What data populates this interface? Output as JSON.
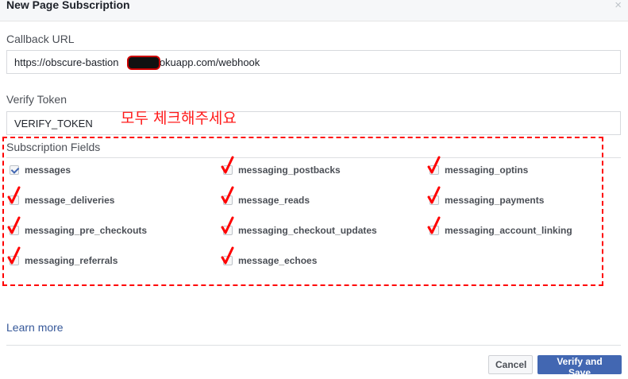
{
  "dialog": {
    "title": "New Page Subscription",
    "close_glyph": "×"
  },
  "callback": {
    "label": "Callback URL",
    "value": "https://obscure-bastion        .herokuapp.com/webhook"
  },
  "verify": {
    "label": "Verify Token",
    "value": "VERIFY_TOKEN"
  },
  "annotation": {
    "text": "모두 체크해주세요",
    "color": "#ff1a1a"
  },
  "subscription": {
    "label": "Subscription Fields",
    "fields": [
      {
        "label": "messages",
        "checked": true,
        "red_mark": false
      },
      {
        "label": "messaging_postbacks",
        "checked": false,
        "red_mark": true
      },
      {
        "label": "messaging_optins",
        "checked": false,
        "red_mark": true
      },
      {
        "label": "message_deliveries",
        "checked": false,
        "red_mark": true
      },
      {
        "label": "message_reads",
        "checked": false,
        "red_mark": true
      },
      {
        "label": "messaging_payments",
        "checked": false,
        "red_mark": true
      },
      {
        "label": "messaging_pre_checkouts",
        "checked": false,
        "red_mark": true
      },
      {
        "label": "messaging_checkout_updates",
        "checked": false,
        "red_mark": true
      },
      {
        "label": "messaging_account_linking",
        "checked": false,
        "red_mark": true
      },
      {
        "label": "messaging_referrals",
        "checked": false,
        "red_mark": true
      },
      {
        "label": "message_echoes",
        "checked": false,
        "red_mark": true
      }
    ]
  },
  "footer": {
    "learn_more": "Learn more",
    "cancel": "Cancel",
    "verify_save": "Verify and Save"
  },
  "colors": {
    "accent": "#4267b2",
    "link": "#365899",
    "annotation_red": "#ff0000"
  }
}
